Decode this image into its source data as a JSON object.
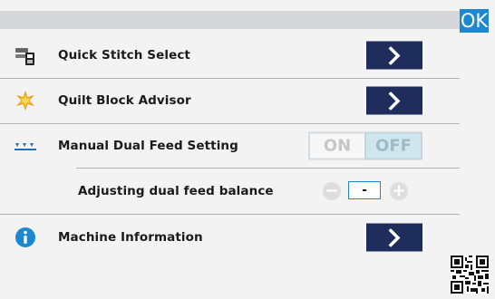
{
  "header": {
    "ok_label": "OK"
  },
  "rows": [
    {
      "label": "Quick Stitch Select",
      "icon": "quick-stitch-icon",
      "control": "arrow-button"
    },
    {
      "label": "Quilt Block Advisor",
      "icon": "quilt-block-icon",
      "control": "arrow-button"
    },
    {
      "label": "Manual Dual Feed Setting",
      "icon": "dual-feed-icon",
      "control": "toggle"
    },
    {
      "label": "Adjusting dual feed balance",
      "control": "stepper"
    },
    {
      "label": "Machine Information",
      "icon": "info-icon",
      "control": "arrow-button"
    }
  ],
  "dual_feed_toggle": {
    "on_label": "ON",
    "off_label": "OFF",
    "selected": "OFF"
  },
  "dual_feed_balance": {
    "value": "-",
    "decrease_label": "−",
    "increase_label": "+"
  },
  "icons": {
    "arrow": "chevron-right-icon",
    "corner": "qr-code-icon"
  },
  "colors": {
    "accent": "#1b88cf",
    "arrow_button": "#1f2d5c",
    "background": "#f3f3f4",
    "header_strip": "#d5d6d9"
  }
}
